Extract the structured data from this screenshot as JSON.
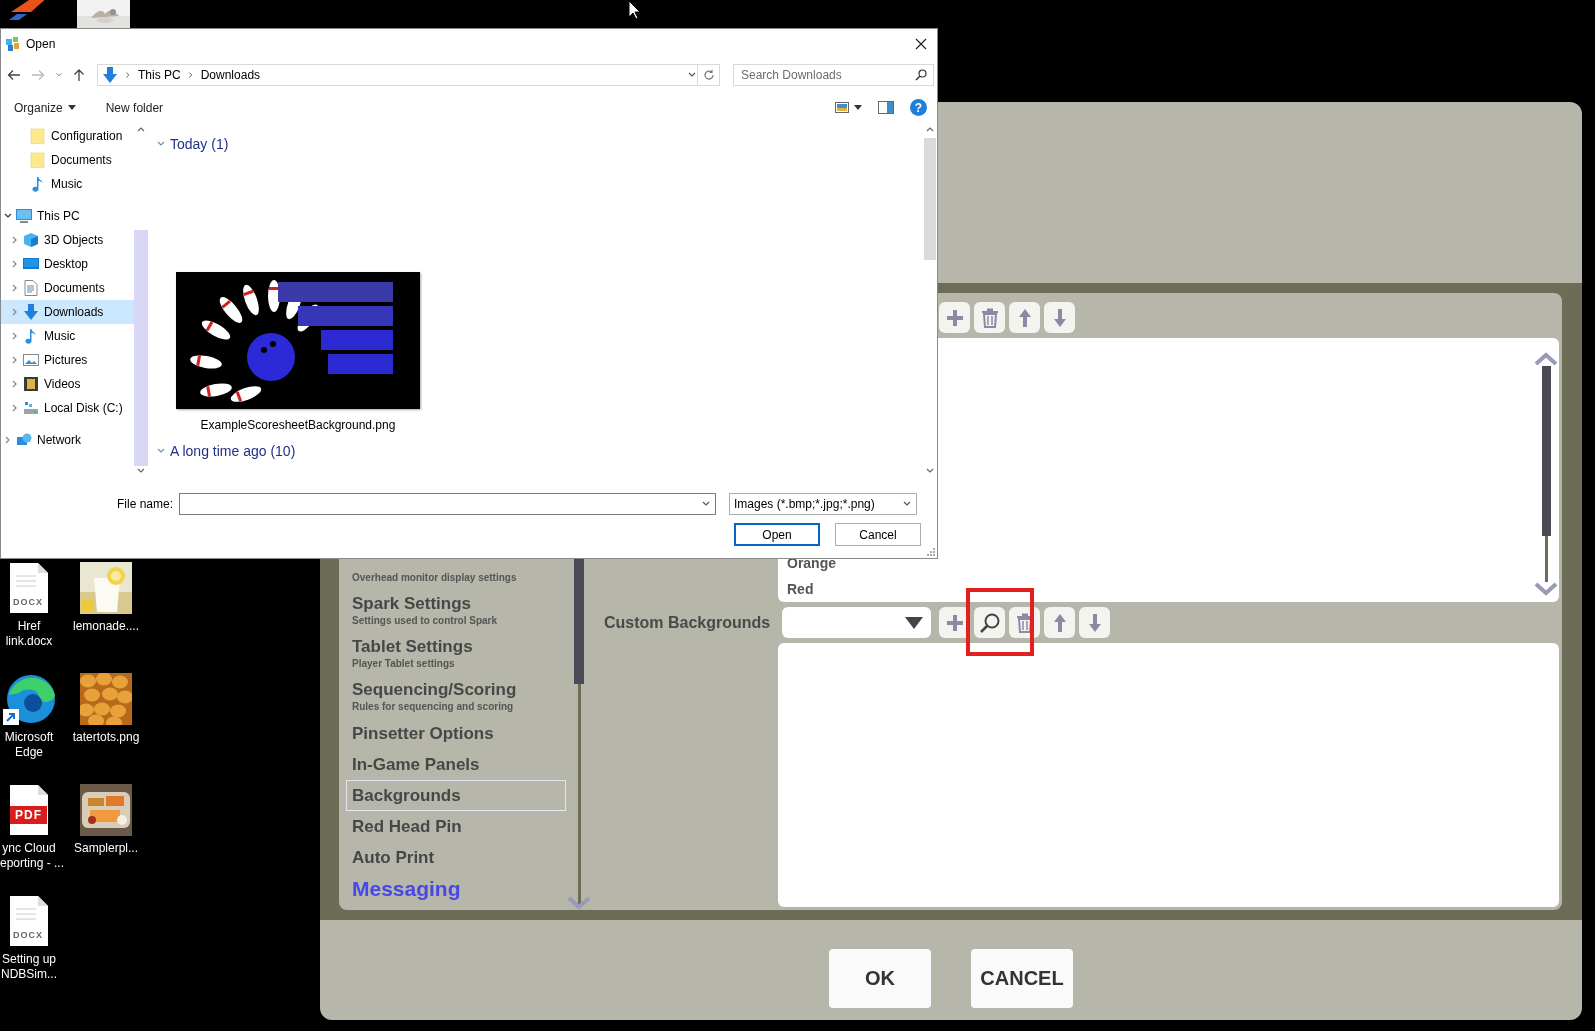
{
  "desktop_top": [
    {
      "kind": "app"
    },
    {
      "kind": "picture"
    }
  ],
  "open_dialog": {
    "title": "Open",
    "path": [
      "This PC",
      "Downloads"
    ],
    "search": {
      "placeholder": "Search Downloads"
    },
    "toolbar": [
      "Organize",
      "New folder"
    ],
    "help": "?",
    "quick_access": [
      {
        "label": "Configuration",
        "kind": "folder",
        "selected": false
      },
      {
        "label": "Documents",
        "kind": "folder",
        "selected": false
      },
      {
        "label": "Music",
        "kind": "music",
        "selected": false
      }
    ],
    "tree": [
      {
        "label": "This PC",
        "kind": "computer",
        "expanded": true,
        "selected": false,
        "children": [
          {
            "label": "3D Objects",
            "kind": "cube",
            "expanded": false,
            "selected": false
          },
          {
            "label": "Desktop",
            "kind": "desktop",
            "expanded": false,
            "selected": false
          },
          {
            "label": "Documents",
            "kind": "document",
            "expanded": false,
            "selected": false
          },
          {
            "label": "Downloads",
            "kind": "download",
            "expanded": false,
            "selected": true
          },
          {
            "label": "Music",
            "kind": "music",
            "expanded": false,
            "selected": false
          },
          {
            "label": "Pictures",
            "kind": "pictures",
            "expanded": false,
            "selected": false
          },
          {
            "label": "Videos",
            "kind": "videos",
            "expanded": false,
            "selected": false
          },
          {
            "label": "Local Disk (C:)",
            "kind": "drive",
            "expanded": false,
            "selected": false
          }
        ]
      },
      {
        "label": "Network",
        "kind": "network",
        "expanded": false,
        "selected": false
      }
    ],
    "groups": [
      {
        "label": "Today (1)",
        "expanded": true,
        "files": [
          {
            "name": "ExampleScoresheetBackground.png",
            "kind": "picture"
          }
        ]
      },
      {
        "label": "A long time ago (10)",
        "expanded": true
      }
    ],
    "file_name": {
      "label": "File name:"
    },
    "file_type": "Images  (*.bmp;*.jpg;*.png)",
    "buttons": [
      {
        "label": "Open",
        "default": true
      },
      {
        "label": "Cancel",
        "default": false
      }
    ]
  },
  "settings_window": {
    "nav": [
      {
        "subtitle": "Overhead monitor display settings",
        "selected": false,
        "highlighted": false
      },
      {
        "title": "Spark Settings",
        "subtitle": "Settings used to control Spark",
        "selected": false,
        "highlighted": false
      },
      {
        "title": "Tablet Settings",
        "subtitle": "Player Tablet settings",
        "selected": false,
        "highlighted": false
      },
      {
        "title": "Sequencing/Scoring",
        "subtitle": "Rules for sequencing and scoring",
        "selected": false,
        "highlighted": false
      },
      {
        "title": "Pinsetter Options",
        "selected": false,
        "highlighted": false
      },
      {
        "title": "In-Game Panels",
        "selected": false,
        "highlighted": false
      },
      {
        "title": "Backgrounds",
        "selected": true,
        "highlighted": false
      },
      {
        "title": "Red Head Pin",
        "selected": false,
        "highlighted": false
      },
      {
        "title": "Auto Print",
        "selected": false,
        "highlighted": false
      },
      {
        "title": "Messaging",
        "selected": false,
        "highlighted": true
      }
    ],
    "standard_backgrounds": {
      "toolbar": [
        {
          "kind": "add"
        },
        {
          "kind": "delete"
        },
        {
          "kind": "up"
        },
        {
          "kind": "down"
        }
      ],
      "items": [
        "Orange",
        "Red"
      ]
    },
    "custom_backgrounds": {
      "label": "Custom Backgrounds",
      "toolbar": [
        {
          "kind": "add"
        },
        {
          "kind": "search"
        },
        {
          "kind": "delete"
        },
        {
          "kind": "up"
        },
        {
          "kind": "down"
        }
      ]
    },
    "buttons": [
      "OK",
      "CANCEL"
    ]
  },
  "desktop_icons": [
    {
      "lines": [
        "Href",
        "link.docx"
      ],
      "kind": "docx",
      "badge": "DOCX"
    },
    {
      "lines": [
        "lemonade...."
      ],
      "kind": "picture"
    },
    {
      "lines": [
        "Microsoft",
        "Edge"
      ],
      "kind": "edge"
    },
    {
      "lines": [
        "tatertots.png"
      ],
      "kind": "picture"
    },
    {
      "lines": [
        "ync Cloud",
        "eporting - ..."
      ],
      "kind": "pdf",
      "badge": "PDF"
    },
    {
      "lines": [
        "Samplerpl..."
      ],
      "kind": "picture"
    },
    {
      "lines": [
        "Setting up",
        "NDBSim..."
      ],
      "kind": "docx",
      "badge": "DOCX"
    }
  ]
}
